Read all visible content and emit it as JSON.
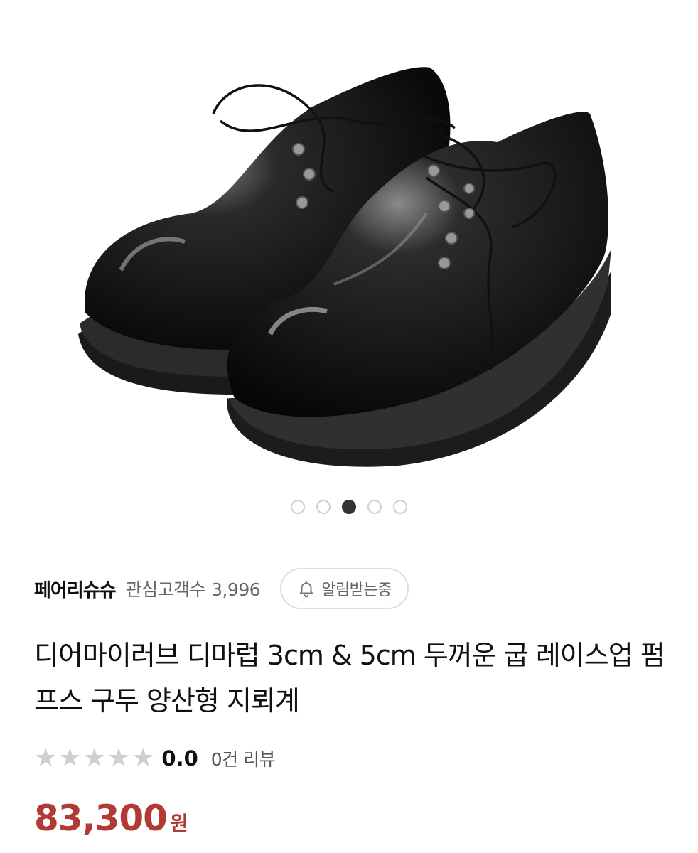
{
  "gallery": {
    "image_alt": "black patent leather lace-up shoes",
    "slide_count": 5,
    "active_index": 2
  },
  "seller": {
    "name": "페어리슈슈",
    "interest_label": "관심고객수",
    "interest_count": "3,996",
    "alarm_label": "알림받는중"
  },
  "product": {
    "title": "디어마이러브 디마럽 3cm & 5cm 두꺼운 굽 레이스업 펌프스 구두 양산형 지뢰계",
    "rating": "0.0",
    "rating_fraction": 0,
    "review_count": "0건 리뷰",
    "price": "83,300",
    "currency": "원"
  },
  "colors": {
    "price": "#b23a35",
    "active_dot": "#333333",
    "inactive_dot_border": "#d0d0d0",
    "star_empty": "#cfcfcf"
  },
  "icons": {
    "alarm": "bell-icon",
    "star": "star-icon"
  }
}
